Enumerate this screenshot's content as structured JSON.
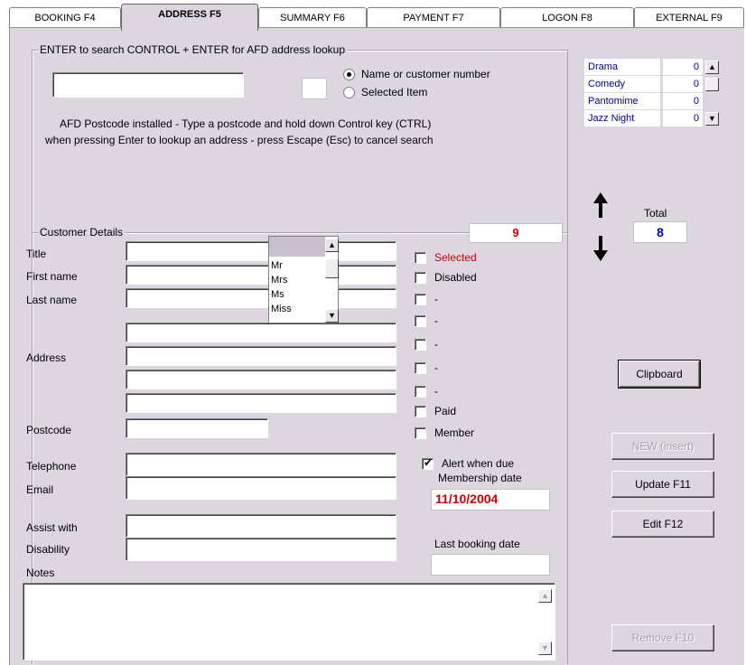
{
  "tabs": [
    {
      "label": "BOOKING F4"
    },
    {
      "label": "ADDRESS F5"
    },
    {
      "label": "SUMMARY F6"
    },
    {
      "label": "PAYMENT F7"
    },
    {
      "label": "LOGON F8"
    },
    {
      "label": "EXTERNAL F9"
    }
  ],
  "search": {
    "title": "ENTER to search   CONTROL + ENTER for AFD address lookup",
    "value": "",
    "small_value": "",
    "radio_name": "Name or customer number",
    "radio_selected": "Selected Item",
    "hint_line1": "AFD Postcode installed  -  Type a postcode and hold down Control key (CTRL)",
    "hint_line2": "when pressing Enter to lookup an address - press Escape (Esc) to cancel search"
  },
  "categories": [
    {
      "name": "Drama",
      "value": "0"
    },
    {
      "name": "Comedy",
      "value": "0"
    },
    {
      "name": "Pantomime",
      "value": "0"
    },
    {
      "name": "Jazz Night",
      "value": "0"
    }
  ],
  "total": {
    "label": "Total",
    "value": "8"
  },
  "customer": {
    "title": "Customer Details",
    "count": "9",
    "labels": {
      "title": "Title",
      "first_name": "First name",
      "last_name": "Last name",
      "address": "Address",
      "postcode": "Postcode",
      "telephone": "Telephone",
      "email": "Email",
      "assist": "Assist with",
      "disability": "Disability",
      "notes": "Notes"
    },
    "title_options": [
      "Mr",
      "Mrs",
      "Ms",
      "Miss"
    ],
    "checkboxes": [
      {
        "label": "Selected",
        "checked": false
      },
      {
        "label": "Disabled",
        "checked": false
      },
      {
        "label": "-",
        "checked": false
      },
      {
        "label": "-",
        "checked": false
      },
      {
        "label": "-",
        "checked": false
      },
      {
        "label": "-",
        "checked": false
      },
      {
        "label": "-",
        "checked": false
      },
      {
        "label": "Paid",
        "checked": false
      },
      {
        "label": "Member",
        "checked": false
      }
    ],
    "alert_label": "Alert when due",
    "membership_label": "Membership date",
    "membership_date": "11/10/2004",
    "last_booking_label": "Last booking date",
    "last_booking_date": ""
  },
  "buttons": {
    "clipboard": "Clipboard",
    "new": "NEW (insert)",
    "update": "Update  F11",
    "edit": "Edit  F12",
    "remove": "Remove  F10"
  },
  "colors": {
    "panel": "#ddd5e0",
    "accent_blue": "#000099",
    "accent_red": "#cc0000"
  }
}
